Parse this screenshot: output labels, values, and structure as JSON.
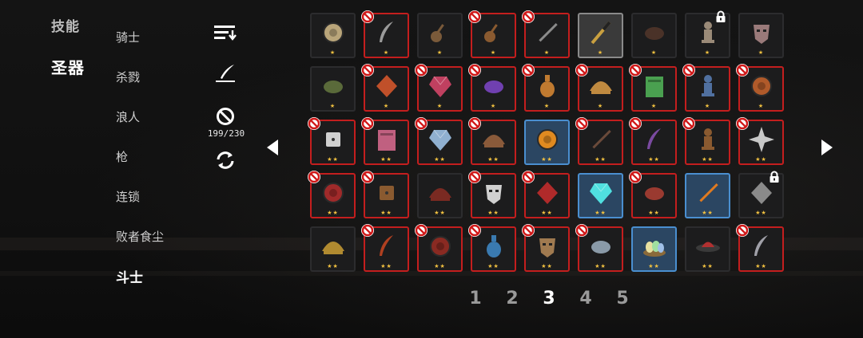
{
  "main_tabs": [
    {
      "label": "技能",
      "active": false
    },
    {
      "label": "圣器",
      "active": true
    }
  ],
  "categories": [
    {
      "label": "骑士",
      "active": false
    },
    {
      "label": "杀戮",
      "active": false
    },
    {
      "label": "浪人",
      "active": false
    },
    {
      "label": "枪",
      "active": false
    },
    {
      "label": "连锁",
      "active": false
    },
    {
      "label": "败者食尘",
      "active": false
    },
    {
      "label": "斗士",
      "active": true
    }
  ],
  "tools": {
    "sort_icon": "sort-icon",
    "quill_icon": "quill-icon",
    "ban_icon": "ban-icon",
    "counter": "199/230",
    "refresh_icon": "refresh-icon"
  },
  "nav": {
    "prev_icon": "arrow-left-icon",
    "next_icon": "arrow-right-icon"
  },
  "pagination": {
    "pages": [
      "1",
      "2",
      "3",
      "4",
      "5"
    ],
    "current": "3"
  },
  "grid": {
    "columns": 9,
    "rows": 5,
    "slots": [
      {
        "item": "bronze-disc",
        "stars": 1,
        "blocked": false,
        "state": "normal"
      },
      {
        "item": "grey-feather",
        "stars": 1,
        "blocked": true,
        "state": "normal"
      },
      {
        "item": "lute",
        "stars": 1,
        "blocked": false,
        "state": "normal"
      },
      {
        "item": "banjo",
        "stars": 1,
        "blocked": true,
        "state": "normal"
      },
      {
        "item": "spear",
        "stars": 1,
        "blocked": true,
        "state": "normal"
      },
      {
        "item": "pen",
        "stars": 1,
        "blocked": false,
        "state": "selected"
      },
      {
        "item": "dark-stone",
        "stars": 1,
        "blocked": false,
        "state": "normal"
      },
      {
        "item": "chess-king",
        "stars": 1,
        "blocked": false,
        "state": "normal",
        "locked": true
      },
      {
        "item": "mask",
        "stars": 1,
        "blocked": false,
        "state": "normal"
      },
      {
        "item": "green-boot",
        "stars": 1,
        "blocked": false,
        "state": "normal"
      },
      {
        "item": "red-aura",
        "stars": 1,
        "blocked": true,
        "state": "normal"
      },
      {
        "item": "crystal-crown",
        "stars": 1,
        "blocked": true,
        "state": "normal"
      },
      {
        "item": "purple-eggplant",
        "stars": 1,
        "blocked": true,
        "state": "normal"
      },
      {
        "item": "orange-bottle",
        "stars": 1,
        "blocked": true,
        "state": "normal"
      },
      {
        "item": "golden-shell",
        "stars": 1,
        "blocked": true,
        "state": "normal"
      },
      {
        "item": "green-book",
        "stars": 1,
        "blocked": true,
        "state": "normal"
      },
      {
        "item": "blue-robot",
        "stars": 1,
        "blocked": true,
        "state": "normal"
      },
      {
        "item": "red-eye",
        "stars": 1,
        "blocked": true,
        "state": "normal"
      },
      {
        "item": "dice",
        "stars": 2,
        "blocked": true,
        "state": "normal"
      },
      {
        "item": "pink-tome",
        "stars": 2,
        "blocked": true,
        "state": "normal"
      },
      {
        "item": "blue-claws",
        "stars": 2,
        "blocked": true,
        "state": "normal"
      },
      {
        "item": "brown-cape",
        "stars": 2,
        "blocked": true,
        "state": "normal"
      },
      {
        "item": "orange-shield",
        "stars": 2,
        "blocked": false,
        "state": "highlight"
      },
      {
        "item": "dark-sword",
        "stars": 2,
        "blocked": true,
        "state": "normal"
      },
      {
        "item": "purple-feather",
        "stars": 2,
        "blocked": true,
        "state": "normal"
      },
      {
        "item": "brown-sprout",
        "stars": 2,
        "blocked": true,
        "state": "normal"
      },
      {
        "item": "snowflake",
        "stars": 2,
        "blocked": true,
        "state": "normal"
      },
      {
        "item": "red-orb",
        "stars": 2,
        "blocked": true,
        "state": "normal"
      },
      {
        "item": "wood-barrel",
        "stars": 2,
        "blocked": true,
        "state": "normal"
      },
      {
        "item": "red-shield",
        "stars": 2,
        "blocked": false,
        "state": "normal"
      },
      {
        "item": "skull",
        "stars": 2,
        "blocked": true,
        "state": "normal"
      },
      {
        "item": "red-scarf",
        "stars": 2,
        "blocked": true,
        "state": "normal"
      },
      {
        "item": "cyan-mirror",
        "stars": 2,
        "blocked": false,
        "state": "highlight"
      },
      {
        "item": "red-meat",
        "stars": 2,
        "blocked": true,
        "state": "normal"
      },
      {
        "item": "fire-sword",
        "stars": 2,
        "blocked": false,
        "state": "highlight"
      },
      {
        "item": "grey-cloth",
        "stars": 2,
        "blocked": false,
        "state": "normal",
        "locked": true
      },
      {
        "item": "golden-hat",
        "stars": 2,
        "blocked": false,
        "state": "normal"
      },
      {
        "item": "red-horn",
        "stars": 2,
        "blocked": true,
        "state": "normal"
      },
      {
        "item": "red-wheel",
        "stars": 2,
        "blocked": true,
        "state": "normal"
      },
      {
        "item": "blue-flame",
        "stars": 2,
        "blocked": true,
        "state": "normal"
      },
      {
        "item": "brown-mask",
        "stars": 2,
        "blocked": true,
        "state": "normal"
      },
      {
        "item": "grey-rock",
        "stars": 2,
        "blocked": true,
        "state": "normal"
      },
      {
        "item": "egg-nest",
        "stars": 2,
        "blocked": false,
        "state": "highlight"
      },
      {
        "item": "red-ufo",
        "stars": 2,
        "blocked": false,
        "state": "normal"
      },
      {
        "item": "grey-hook",
        "stars": 2,
        "blocked": true,
        "state": "normal"
      }
    ]
  },
  "colors": {
    "blocked_border": "#c41e1e",
    "highlight_border": "#4a8fd0",
    "star": "#f0c040"
  }
}
